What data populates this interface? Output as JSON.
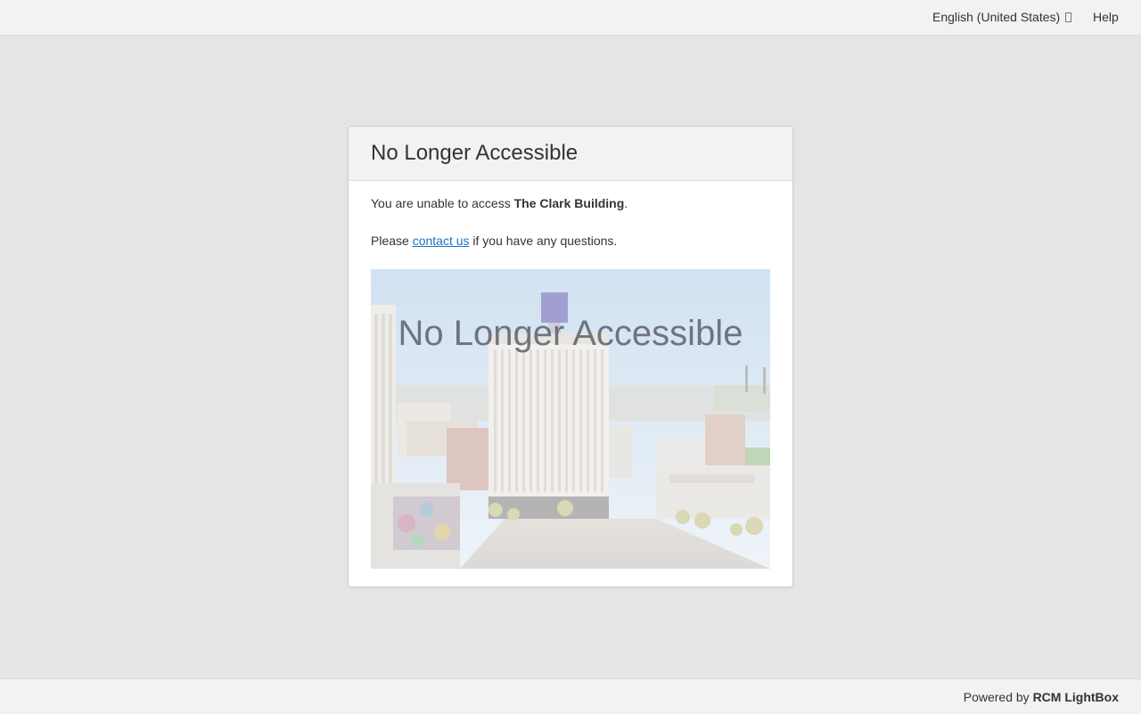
{
  "topbar": {
    "language": "English (United States)",
    "help": "Help"
  },
  "panel": {
    "title": "No Longer Accessible",
    "message_prefix": "You are unable to access ",
    "property_name": "The Clark Building",
    "message_suffix": ".",
    "contact_prefix": "Please ",
    "contact_link": "contact us",
    "contact_suffix": " if you have any questions.",
    "image_overlay": "No Longer Accessible"
  },
  "footer": {
    "powered_prefix": "Powered by ",
    "brand": "RCM LightBox"
  },
  "icons": {
    "language_dropdown": "chevron-down-icon"
  }
}
